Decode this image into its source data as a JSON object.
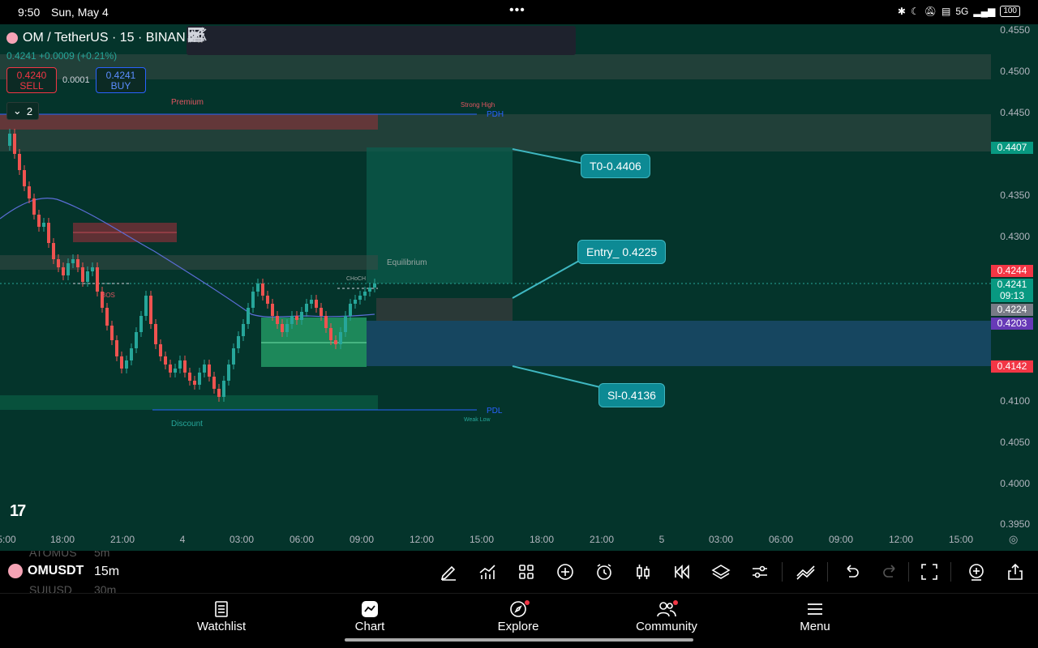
{
  "status_bar": {
    "time": "9:50",
    "date": "Sun, May 4",
    "dots": "•••",
    "network": "5G",
    "battery": "100"
  },
  "header": {
    "symbol_title": "OM / TetherUS · 15 · BINAN",
    "last_price": "0.4241",
    "change": "+0.0009 (+0.21%)",
    "sell_price": "0.4240",
    "sell_label": "SELL",
    "spread": "0.0001",
    "buy_price": "0.4241",
    "buy_label": "BUY",
    "indicator_count": "2"
  },
  "drawing_tools": [
    "cursor-lines-icon",
    "arrow-icon",
    "trend-icon",
    "rectangle-icon",
    "text-icon",
    "pattern-icon",
    "line-icon",
    "horizontal-ray-icon",
    "horizontal-line-icon",
    "parallel-channel-icon",
    "fib-icon",
    "comment-icon"
  ],
  "chart_labels": {
    "premium": "Premium",
    "strong_high": "Strong High",
    "pdh": "PDH",
    "equilibrium": "Equilibrium",
    "choch": "CHoCH",
    "bos": "BOS",
    "discount": "Discount",
    "pdl": "PDL",
    "weak_low": "Weak Low"
  },
  "callouts": {
    "tp": "T0-0.4406",
    "entry": "Entry_ 0.4225",
    "sl": "Sl-0.4136"
  },
  "price_axis": [
    "0.4550",
    "0.4500",
    "0.4450",
    "0.4350",
    "0.4300",
    "0.4100",
    "0.4050",
    "0.4000",
    "0.3950"
  ],
  "price_tags": {
    "tp": "0.4407",
    "red": "0.4244",
    "current": "0.4241",
    "countdown": "09:13",
    "entry": "0.4224",
    "purple": "0.4203",
    "sl": "0.4142"
  },
  "time_axis": [
    "5:00",
    "18:00",
    "21:00",
    "4",
    "03:00",
    "06:00",
    "09:00",
    "12:00",
    "15:00",
    "18:00",
    "21:00",
    "5",
    "03:00",
    "06:00",
    "09:00",
    "12:00",
    "15:00"
  ],
  "logo": "17",
  "watchlist_strip": {
    "prev_symbol": "ATOMUS",
    "symbol": "OMUSDT",
    "next_symbol": "SUIUSD",
    "prev_interval": "5m",
    "interval": "15m",
    "next_interval": "30m"
  },
  "toolbar_icons": [
    "pencil-icon",
    "indicators-icon",
    "grid-icon",
    "plus-circle-icon",
    "alarm-icon",
    "bar-type-icon",
    "replay-icon",
    "layers-icon",
    "settings-sliders-icon",
    "trend-compare-icon",
    "undo-icon",
    "redo-icon",
    "fullscreen-icon",
    "add-chart-icon",
    "share-icon"
  ],
  "bottom_nav": [
    {
      "label": "Watchlist",
      "icon": "watchlist-icon"
    },
    {
      "label": "Chart",
      "icon": "chart-icon"
    },
    {
      "label": "Explore",
      "icon": "explore-icon"
    },
    {
      "label": "Community",
      "icon": "community-icon"
    },
    {
      "label": "Menu",
      "icon": "menu-icon"
    }
  ],
  "colors": {
    "background": "#04342b",
    "up": "#26a69a",
    "down": "#ef5350",
    "callout": "#0d8a94",
    "sell": "#f23645",
    "buy": "#2962ff"
  }
}
